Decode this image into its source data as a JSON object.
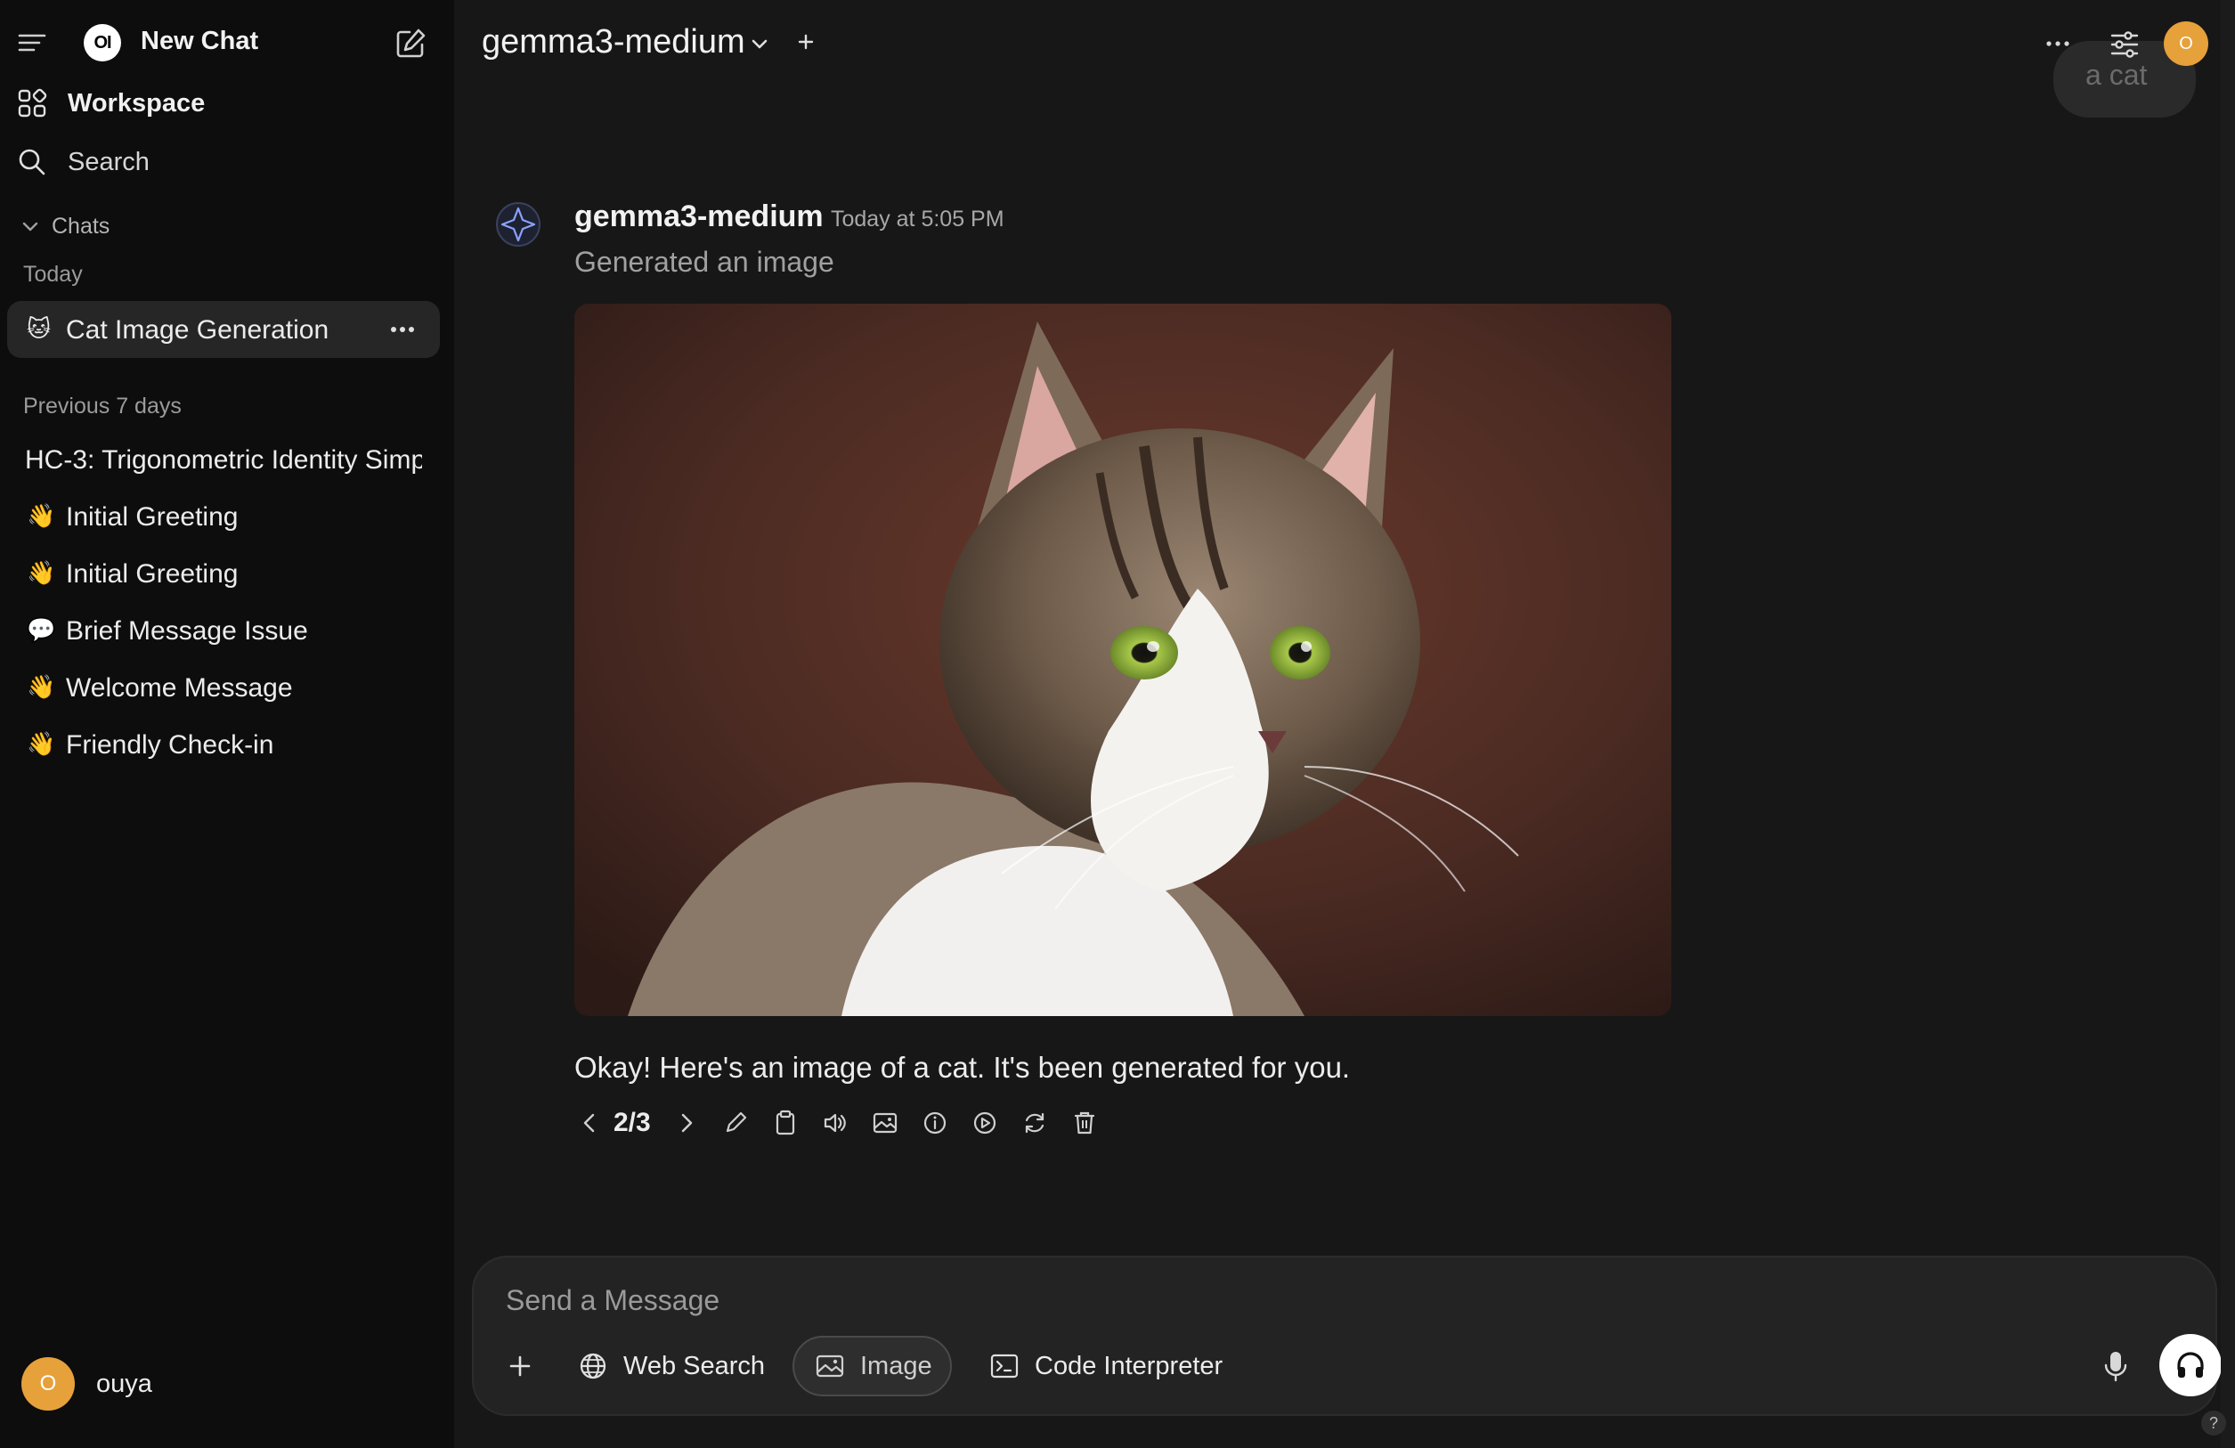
{
  "sidebar": {
    "logo_text": "OI",
    "new_chat_label": "New Chat",
    "workspace_label": "Workspace",
    "search_label": "Search",
    "chats_label": "Chats",
    "groups": [
      {
        "label": "Today",
        "items": [
          {
            "emoji": "🐱",
            "title": "Cat Image Generation",
            "active": true
          }
        ]
      },
      {
        "label": "Previous 7 days",
        "items": [
          {
            "emoji": "",
            "title": "HC-3: Trigonometric Identity Simp"
          },
          {
            "emoji": "👋",
            "title": "Initial Greeting"
          },
          {
            "emoji": "👋",
            "title": "Initial Greeting"
          },
          {
            "emoji": "💬",
            "title": "Brief Message Issue"
          },
          {
            "emoji": "👋",
            "title": "Welcome Message"
          },
          {
            "emoji": "👋",
            "title": "Friendly Check-in"
          }
        ]
      }
    ],
    "user": {
      "initial": "O",
      "name": "ouya"
    }
  },
  "topbar": {
    "model": "gemma3-medium",
    "avatar_initial": "O",
    "previous_user_message": "a cat"
  },
  "message": {
    "model_name": "gemma3-medium",
    "timestamp": "Today at 5:05 PM",
    "status": "Generated an image",
    "image_alt": "Generated image of a tabby cat with green eyes",
    "text": "Okay! Here's an image of a cat. It's been generated for you.",
    "pager": "2/3"
  },
  "composer": {
    "placeholder": "Send a Message",
    "web_search_label": "Web Search",
    "image_label": "Image",
    "code_interpreter_label": "Code Interpreter"
  },
  "help_label": "?",
  "colors": {
    "sidebar_bg": "#0d0d0d",
    "main_bg": "#171717",
    "active_chat_bg": "#262626",
    "avatar": "#e6a13b",
    "composer_bg": "#232323"
  },
  "icons": {
    "menu": "menu-icon",
    "compose": "edit-note-icon",
    "workspace": "grid-icon",
    "search": "search-icon",
    "actions": [
      "chevron-left-icon",
      "chevron-right-icon",
      "pencil-icon",
      "clipboard-icon",
      "speaker-icon",
      "image-icon",
      "info-icon",
      "play-icon",
      "refresh-icon",
      "trash-icon"
    ]
  }
}
